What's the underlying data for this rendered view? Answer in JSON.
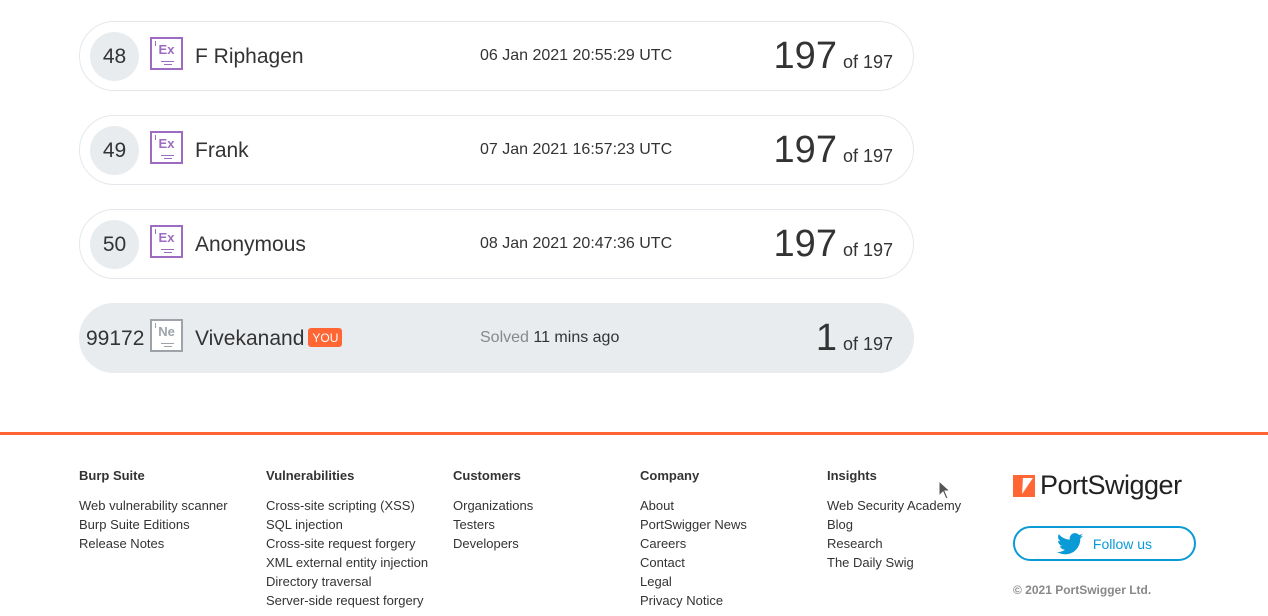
{
  "leaderboard": [
    {
      "rank": "48",
      "badge": "Ex",
      "name": "F Riphagen",
      "date": "06 Jan 2021 20:55:29 UTC",
      "score": "197",
      "of": "of 197"
    },
    {
      "rank": "49",
      "badge": "Ex",
      "name": "Frank",
      "date": "07 Jan 2021 16:57:23 UTC",
      "score": "197",
      "of": "of 197"
    },
    {
      "rank": "50",
      "badge": "Ex",
      "name": "Anonymous",
      "date": "08 Jan 2021 20:47:36 UTC",
      "score": "197",
      "of": "of 197"
    }
  ],
  "me": {
    "rank": "99172",
    "badge": "Ne",
    "name": "Vivekanand",
    "you": "YOU",
    "solved_label": "Solved",
    "solved_time": "11 mins ago",
    "score": "1",
    "of": "of 197"
  },
  "footer": {
    "cols": [
      {
        "title": "Burp Suite",
        "links": [
          "Web vulnerability scanner",
          "Burp Suite Editions",
          "Release Notes"
        ]
      },
      {
        "title": "Vulnerabilities",
        "links": [
          "Cross-site scripting (XSS)",
          "SQL injection",
          "Cross-site request forgery",
          "XML external entity injection",
          "Directory traversal",
          "Server-side request forgery"
        ]
      },
      {
        "title": "Customers",
        "links": [
          "Organizations",
          "Testers",
          "Developers"
        ]
      },
      {
        "title": "Company",
        "links": [
          "About",
          "PortSwigger News",
          "Careers",
          "Contact",
          "Legal",
          "Privacy Notice"
        ]
      },
      {
        "title": "Insights",
        "links": [
          "Web Security Academy",
          "Blog",
          "Research",
          "The Daily Swig"
        ]
      }
    ],
    "logo_text": "PortSwigger",
    "follow_label": "Follow us",
    "copyright": "© 2021 PortSwigger Ltd."
  },
  "colors": {
    "accent": "#ff6633",
    "twitter": "#0a9bd7",
    "expert_badge": "#9d6cc1"
  }
}
